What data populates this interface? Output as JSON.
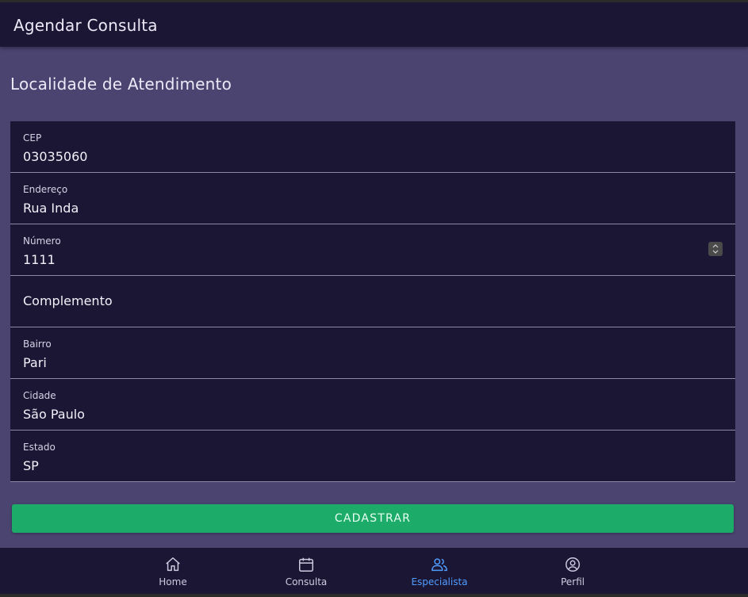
{
  "appbar": {
    "title": "Agendar Consulta"
  },
  "section": {
    "title": "Localidade de Atendimento"
  },
  "form": {
    "fields": [
      {
        "label": "CEP",
        "value": "03035060"
      },
      {
        "label": "Endereço",
        "value": "Rua Inda"
      },
      {
        "label": "Número",
        "value": "1111"
      },
      {
        "label": "",
        "value": "Complemento"
      },
      {
        "label": "Bairro",
        "value": "Pari"
      },
      {
        "label": "Cidade",
        "value": "São Paulo"
      },
      {
        "label": "Estado",
        "value": "SP"
      }
    ],
    "submit_label": "CADASTRAR"
  },
  "bottom_nav": {
    "items": [
      {
        "label": "Home",
        "icon": "home-icon"
      },
      {
        "label": "Consulta",
        "icon": "calendar-icon"
      },
      {
        "label": "Especialista",
        "icon": "users-icon",
        "active": true
      },
      {
        "label": "Perfil",
        "icon": "user-circle-icon"
      }
    ]
  },
  "colors": {
    "appbar_bg": "#1c1635",
    "page_bg": "#4b4471",
    "field_bg": "#1c1635",
    "button_bg": "#1dab6a",
    "active_nav": "#4f9dff"
  }
}
